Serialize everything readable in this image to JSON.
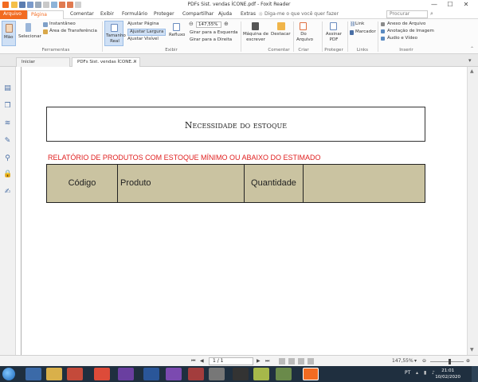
{
  "window": {
    "title": "PDFs Sist. vendas ÍCONE.pdf - Foxit Reader",
    "controls": [
      "—",
      "☐",
      "✕"
    ]
  },
  "menu": {
    "tabs": [
      "Arquivo",
      "Página Inicial",
      "Comentar",
      "Exibir",
      "Formulário",
      "Proteger",
      "Compartilhar",
      "Ajuda",
      "Extras"
    ],
    "tell_me": "Diga-me o que você quer fazer",
    "search_placeholder": "Procurar"
  },
  "ribbon": {
    "hand": "Mão",
    "select": "Selecionar",
    "snapshot": "Instantâneo",
    "clipboard": "Área de Transferência",
    "group_tools": "Ferramentas",
    "actual_size": "Tamanho Real",
    "fit_page": "Ajustar Página",
    "fit_width": "Ajustar Largura",
    "fit_visible": "Ajustar Visível",
    "reflow": "Refluxo",
    "zoom_value": "147,55%",
    "rotate_left": "Girar para a Esquerda",
    "rotate_right": "Girar para a Direita",
    "group_view": "Exibir",
    "typewriter": "Máquina de escrever",
    "highlight": "Destacar",
    "group_comment": "Comentar",
    "from_file": "Do Arquivo",
    "group_create": "Criar",
    "sign_pdf": "Assinar PDF",
    "group_protect": "Proteger",
    "link": "Link",
    "bookmark": "Marcador",
    "group_links": "Links",
    "file_attachment": "Anexo de Arquivo",
    "image_annotation": "Anotação de Imagem",
    "audio_video": "Áudio e Vídeo",
    "group_insert": "Inserir"
  },
  "doc_tabs": [
    "Iniciar",
    "PDFs Sist. vendas ÍCONE..."
  ],
  "document": {
    "heading": "Necessidade do estoque",
    "report_title": "RELATÓRIO DE PRODUTOS COM ESTOQUE MÍNIMO OU ABAIXO DO ESTIMADO",
    "table_headers": [
      "Código",
      "Produto",
      "Quantidade",
      ""
    ],
    "header_bg": "#cac3a1"
  },
  "status": {
    "page": "1 / 1",
    "zoom": "147,55%"
  },
  "taskbar": {
    "lang": "PT",
    "time": "21:01",
    "date": "10/02/2020"
  },
  "colors": {
    "accent": "#f26b21",
    "report_title": "#e02020"
  }
}
